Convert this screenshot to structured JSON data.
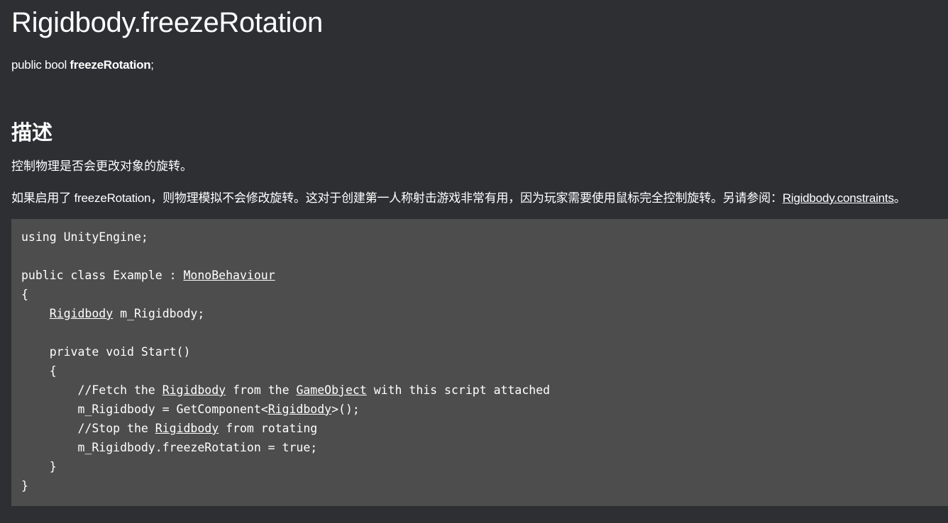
{
  "title": "Rigidbody.freezeRotation",
  "signature": {
    "prefix": "public bool ",
    "name": "freezeRotation",
    "suffix": ";"
  },
  "section_heading": "描述",
  "description": {
    "line1": "控制物理是否会更改对象的旋转。",
    "line2_text": "如果启用了 freezeRotation，则物理模拟不会修改旋转。这对于创建第一人称射击游戏非常有用，因为玩家需要使用鼠标完全控制旋转。另请参阅：",
    "line2_link": "Rigidbody.constraints",
    "line2_end": "。"
  },
  "code": {
    "l1": "using UnityEngine;",
    "l3a": "public class Example : ",
    "l3link": "MonoBehaviour",
    "l4": "{",
    "l5indent": "    ",
    "l5link": "Rigidbody",
    "l5b": " m_Rigidbody;",
    "l7": "    private void Start()",
    "l8": "    {",
    "l9a": "        //Fetch the ",
    "l9link1": "Rigidbody",
    "l9b": " from the ",
    "l9link2": "GameObject",
    "l9c": " with this script attached",
    "l10a": "        m_Rigidbody = GetComponent<",
    "l10link": "Rigidbody",
    "l10b": ">();",
    "l11a": "        //Stop the ",
    "l11link": "Rigidbody",
    "l11b": " from rotating",
    "l12": "        m_Rigidbody.freezeRotation = true;",
    "l13": "    }",
    "l14": "}"
  }
}
